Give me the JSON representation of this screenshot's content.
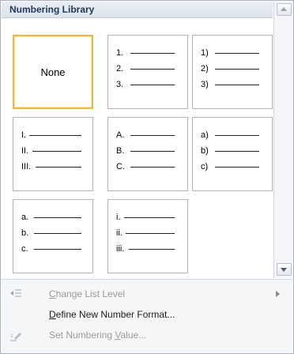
{
  "library": {
    "title": "Numbering Library"
  },
  "cells": [
    {
      "none": "None"
    },
    {
      "markers": [
        "1.",
        "2.",
        "3."
      ]
    },
    {
      "markers": [
        "1)",
        "2)",
        "3)"
      ]
    },
    {
      "markers": [
        "I.",
        "II.",
        "III."
      ]
    },
    {
      "markers": [
        "A.",
        "B.",
        "C."
      ]
    },
    {
      "markers": [
        "a)",
        "b)",
        "c)"
      ]
    },
    {
      "markers": [
        "a.",
        "b.",
        "c."
      ]
    },
    {
      "markers": [
        "i.",
        "ii.",
        "iii."
      ]
    }
  ],
  "menu": {
    "change_level": {
      "first": "C",
      "rest": "hange List Level"
    },
    "define_format": {
      "first": "D",
      "rest": "efine New Number Format..."
    },
    "set_value": {
      "before": "Set Numbering ",
      "accel": "V",
      "after": "alue..."
    }
  },
  "colors": {
    "header_text": "#1e395b",
    "selected_border": "#e5b94c",
    "disabled_text": "#9a9a9a"
  },
  "icons": {
    "change_level": "indent-level-icon",
    "set_value": "pencil-number-icon",
    "submenu": "chevron-right-icon"
  }
}
